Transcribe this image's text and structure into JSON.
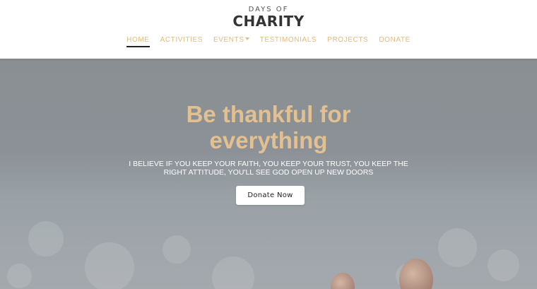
{
  "logo": {
    "top": "DAYS OF",
    "main": "CHARITY"
  },
  "nav": {
    "items": [
      {
        "label": "HOME",
        "active": true
      },
      {
        "label": "ACTIVITIES"
      },
      {
        "label": "EVENTS",
        "dropdown": true
      },
      {
        "label": "TESTIMONIALS"
      },
      {
        "label": "PROJECTS"
      },
      {
        "label": "DONATE"
      }
    ]
  },
  "hero": {
    "title_line1": "Be thankful for",
    "title_line2": "everything",
    "subtitle_line1": "I BELIEVE IF YOU KEEP YOUR FAITH, YOU KEEP YOUR TRUST, YOU KEEP THE",
    "subtitle_line2": "RIGHT ATTITUDE, YOU'LL SEE GOD OPEN UP NEW DOORS",
    "button_label": "Donate Now"
  },
  "colors": {
    "accent": "#e3bb80",
    "title": "#e3c08f",
    "hero_overlay": "#8a8f93"
  },
  "icons": {
    "events_dropdown": "chevron-down-icon"
  }
}
